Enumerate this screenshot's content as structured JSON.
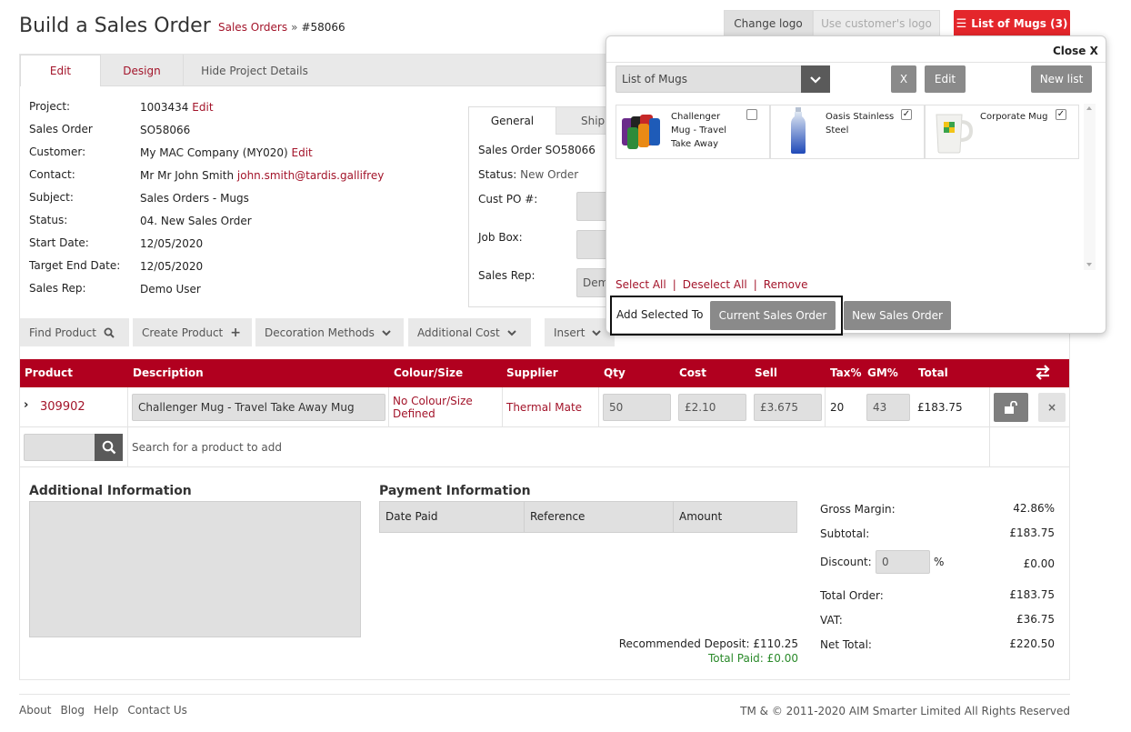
{
  "header": {
    "title": "Build a Sales Order",
    "crumb_link": "Sales Orders",
    "crumb_sep": "»",
    "crumb_current": "#58066",
    "change_logo": "Change logo",
    "use_customer_logo": "Use customer's logo",
    "list_button": "List of Mugs (3)"
  },
  "tabs": [
    "Edit",
    "Design",
    "Hide Project Details"
  ],
  "project": {
    "fields": [
      {
        "label": "Project:",
        "value": "1003434",
        "link": "Edit"
      },
      {
        "label": "Sales Order",
        "value": "SO58066"
      },
      {
        "label": "Customer:",
        "value": "My MAC Company (MY020)",
        "link": "Edit"
      },
      {
        "label": "Contact:",
        "value": "Mr Mr John Smith",
        "link": "john.smith@tardis.gallifrey"
      },
      {
        "label": "Subject:",
        "value": "Sales Orders - Mugs"
      },
      {
        "label": "Status:",
        "value": "04. New Sales Order"
      },
      {
        "label": "Start Date:",
        "value": "12/05/2020"
      },
      {
        "label": "Target End Date:",
        "value": "12/05/2020"
      },
      {
        "label": "Sales Rep:",
        "value": "Demo User"
      }
    ]
  },
  "general": {
    "tabs": [
      "General",
      "Ship"
    ],
    "sales_order": "Sales Order SO58066",
    "status_label": "Status:",
    "status_value": "New Order",
    "cust_po": "Cust PO #:",
    "job_box": "Job Box:",
    "sales_rep": "Sales Rep:",
    "sales_rep_value": "Dem"
  },
  "toolbar": {
    "find_product": "Find Product",
    "create_product": "Create Product",
    "decoration_methods": "Decoration Methods",
    "additional_cost": "Additional Cost",
    "insert": "Insert"
  },
  "table": {
    "headers": [
      "Product",
      "Description",
      "Colour/Size",
      "Supplier",
      "Qty",
      "Cost",
      "Sell",
      "Tax%",
      "GM%",
      "Total"
    ],
    "row": {
      "product": "309902",
      "description": "Challenger Mug - Travel Take Away Mug",
      "colour_size": "No Colour/Size Defined",
      "supplier": "Thermal Mate",
      "qty": "50",
      "cost": "£2.10",
      "sell": "£3.675",
      "tax": "20",
      "gm": "43",
      "total": "£183.75"
    },
    "search_placeholder": "Search for a product to add"
  },
  "additional_info": {
    "title": "Additional Information"
  },
  "payment": {
    "title": "Payment Information",
    "headers": [
      "Date Paid",
      "Reference",
      "Amount"
    ],
    "recommended_deposit": "Recommended Deposit: £110.25",
    "total_paid": "Total Paid: £0.00"
  },
  "summary": {
    "gross_margin_label": "Gross Margin:",
    "gross_margin": "42.86%",
    "subtotal_label": "Subtotal:",
    "subtotal": "£183.75",
    "discount_label": "Discount:",
    "discount_input": "0",
    "discount_pct": "%",
    "discount": "£0.00",
    "total_order_label": "Total Order:",
    "total_order": "£183.75",
    "vat_label": "VAT:",
    "vat": "£36.75",
    "net_total_label": "Net Total:",
    "net_total": "£220.50"
  },
  "modal": {
    "close": "Close X",
    "list_select": "List of Mugs",
    "x_button": "X",
    "edit_button": "Edit",
    "new_list_button": "New list",
    "products": [
      {
        "name": "Challenger Mug - Travel Take Away",
        "checked": false
      },
      {
        "name": "Oasis Stainless Steel",
        "checked": true
      },
      {
        "name": "Corporate Mug",
        "checked": true
      }
    ],
    "select_all": "Select All",
    "deselect_all": "Deselect All",
    "remove": "Remove",
    "pipe": "|",
    "add_selected_to": "Add Selected To",
    "current_sales_order": "Current Sales Order",
    "new_sales_order": "New Sales Order"
  },
  "footer": {
    "links": [
      "About",
      "Blog",
      "Help",
      "Contact Us"
    ],
    "copyright": "TM & © 2011-2020 AIM Smarter Limited All Rights Reserved"
  },
  "colors": {
    "brand_red": "#b1001f",
    "link_red": "#a3142a",
    "total_paid_green": "#2a8a2a"
  }
}
